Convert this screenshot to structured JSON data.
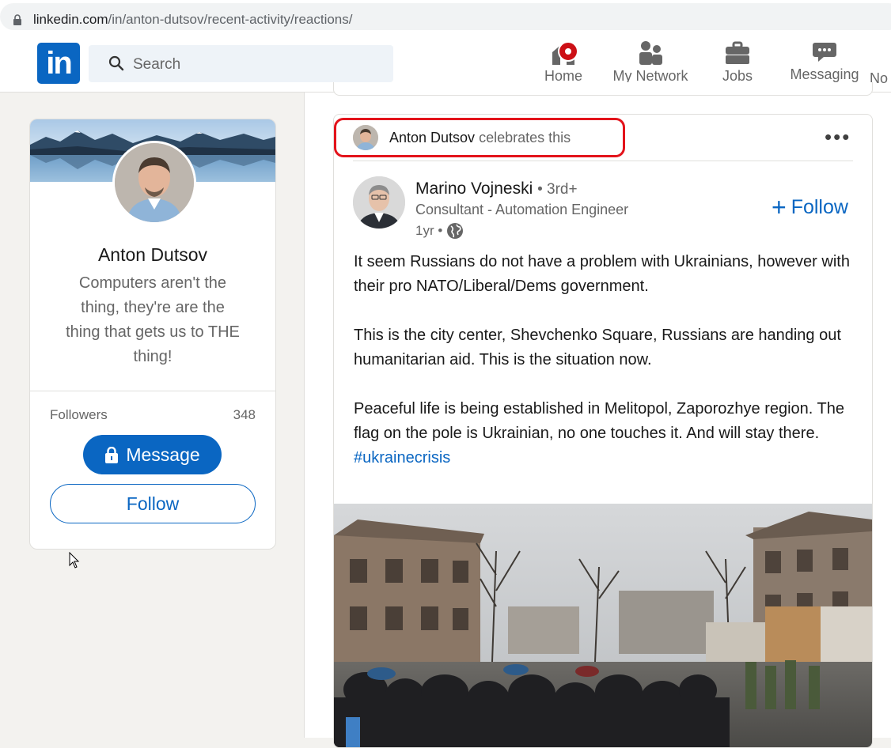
{
  "browser": {
    "url_host": "linkedin.com",
    "url_path": "/in/anton-dutsov/recent-activity/reactions/"
  },
  "nav": {
    "logo_text": "in",
    "search_placeholder": "Search",
    "items": [
      {
        "label": "Home",
        "icon": "home-icon"
      },
      {
        "label": "My Network",
        "icon": "network-icon"
      },
      {
        "label": "Jobs",
        "icon": "briefcase-icon"
      },
      {
        "label": "Messaging",
        "icon": "messaging-icon"
      },
      {
        "label": "No"
      }
    ]
  },
  "profile": {
    "name": "Anton Dutsov",
    "headline": "Computers aren't the thing, they're are the thing that gets us to THE thing!",
    "followers_label": "Followers",
    "followers_count": "348",
    "message_button": "Message",
    "follow_button": "Follow"
  },
  "post": {
    "actor_name": "Anton Dutsov",
    "action_text": "celebrates this",
    "more_label": "•••",
    "author": {
      "name": "Marino Vojneski",
      "degree": "• 3rd+",
      "title": "Consultant - Automation Engineer",
      "time": "1yr •"
    },
    "follow_label": "Follow",
    "paragraphs": [
      "It seem Russians do not have a problem with Ukrainians, however with their pro NATO/Liberal/Dems government.",
      "This is the city center, Shevchenko Square, Russians are handing out humanitarian aid. This is the situation now.",
      "Peaceful life is being established in Melitopol, Zaporozhye region. The flag on the pole is Ukrainian, no one touches it. And will stay there."
    ],
    "hashtag": "#ukrainecrisis"
  },
  "colors": {
    "brand": "#0a66c2",
    "highlight": "#e3131b",
    "notification": "#cc1016"
  }
}
